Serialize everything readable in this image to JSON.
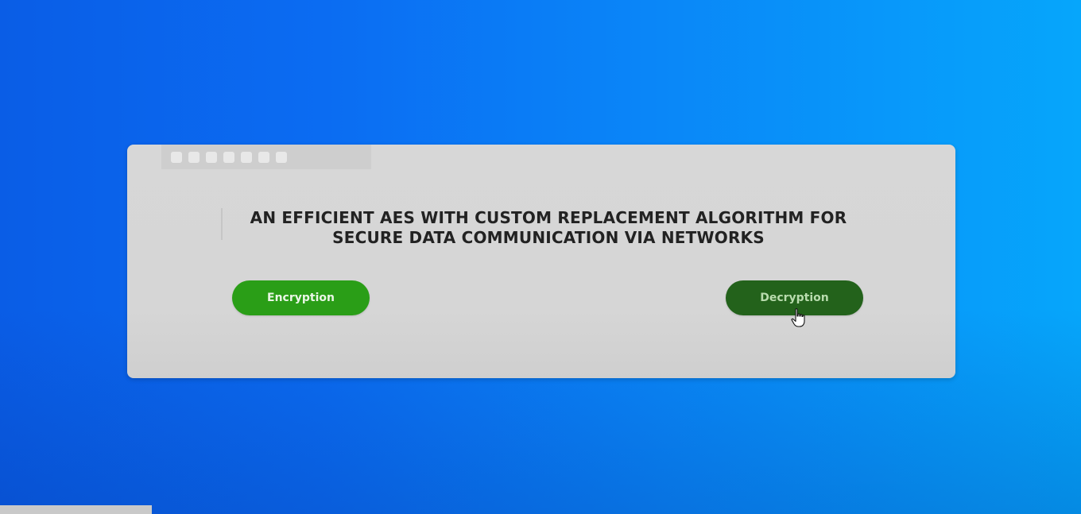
{
  "main": {
    "title": "AN EFFICIENT AES WITH CUSTOM REPLACEMENT ALGORITHM FOR SECURE DATA COMMUNICATION VIA NETWORKS",
    "buttons": {
      "encryption_label": "Encryption",
      "decryption_label": "Decryption"
    }
  },
  "icons": {
    "cursor": "hand-pointer-icon"
  },
  "colors": {
    "background_left": "#0a5de6",
    "background_right": "#06a6fb",
    "card": "#d7d7d7",
    "encryption_button": "#2a9e17",
    "decryption_button": "#23621b",
    "title_text": "#222222"
  }
}
